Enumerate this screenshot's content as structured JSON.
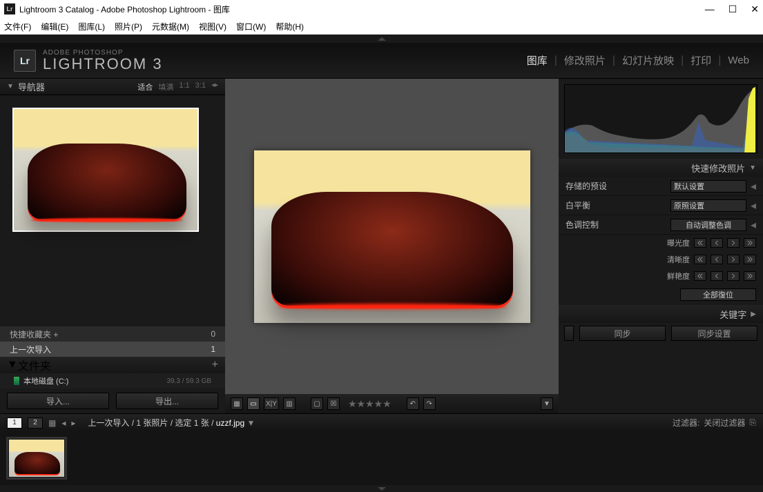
{
  "window": {
    "title": "Lightroom 3 Catalog - Adobe Photoshop Lightroom - 图库"
  },
  "menus": [
    "文件(F)",
    "编辑(E)",
    "图库(L)",
    "照片(P)",
    "元数据(M)",
    "视图(V)",
    "窗口(W)",
    "帮助(H)"
  ],
  "brand": {
    "top": "ADOBE PHOTOSHOP",
    "bot": "LIGHTROOM 3",
    "badge": "Lr"
  },
  "nav": [
    "图库",
    "修改照片",
    "幻灯片放映",
    "打印",
    "Web"
  ],
  "navigator": {
    "title": "导航器",
    "zoom_fit": "适合",
    "zoom_fill": "填满",
    "zoom_1": "1:1",
    "zoom_3": "3:1"
  },
  "quick": {
    "fav": "快捷收藏夹  +",
    "fav_count": "0",
    "last": "上一次导入",
    "last_count": "1"
  },
  "folders": {
    "title": "文件夹",
    "plus": "+",
    "drive": "本地磁盘 (C:)",
    "size": "39.3 / 59.3 GB"
  },
  "left_buttons": {
    "import": "导入...",
    "export": "导出..."
  },
  "quick_dev": {
    "title": "快速修改照片",
    "preset_lbl": "存储的预设",
    "preset_val": "默认设置",
    "wb_lbl": "白平衡",
    "wb_val": "原照设置",
    "tone_lbl": "色调控制",
    "tone_btn": "自动调整色调",
    "exposure": "曝光度",
    "clarity": "清晰度",
    "vibrance": "鲜艳度",
    "reset": "全部復位"
  },
  "keywords": {
    "title": "关键字"
  },
  "sync": {
    "sync": "同步",
    "settings": "同步设置"
  },
  "filmstrip": {
    "screen1": "1",
    "screen2": "2",
    "breadcrumb": "上一次导入 / 1 张照片 / 选定 1 张 /",
    "filename": "uzzf.jpg",
    "filter_lbl": "过滤器:",
    "filter_val": "关闭过滤器"
  }
}
